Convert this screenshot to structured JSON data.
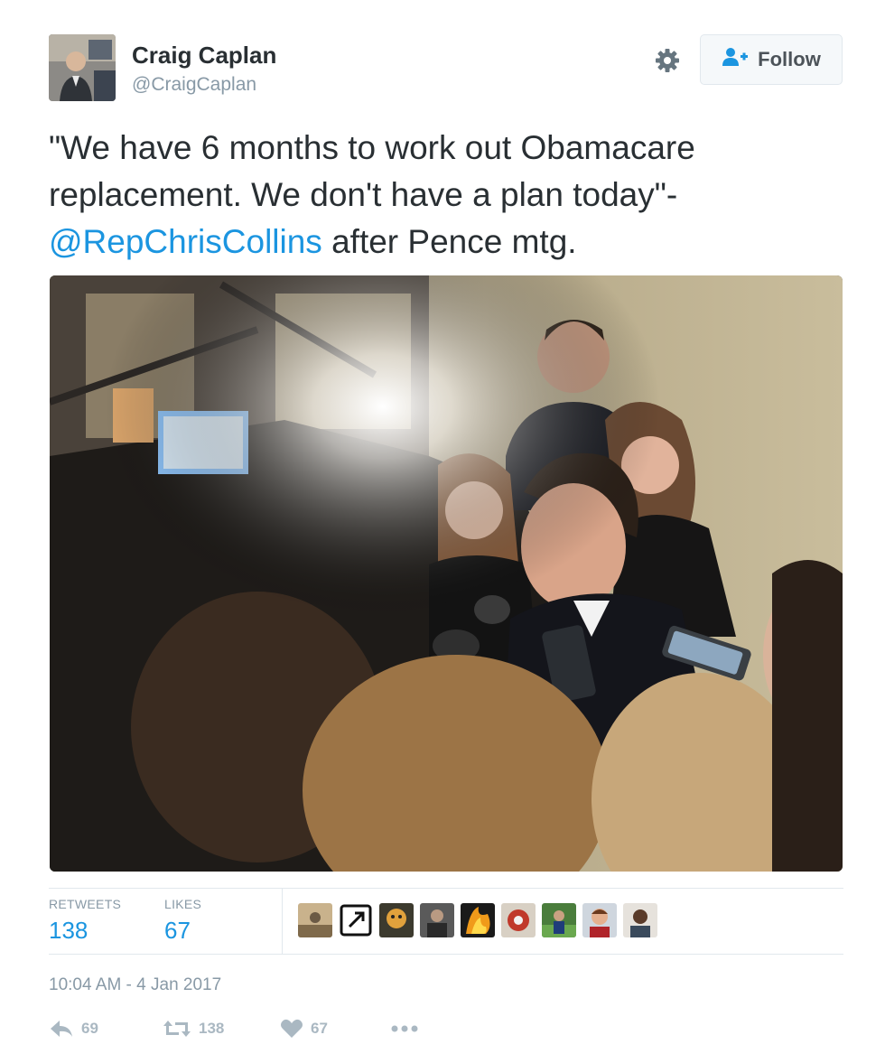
{
  "author": {
    "name": "Craig Caplan",
    "handle": "@CraigCaplan"
  },
  "header": {
    "settings_icon": "gear-icon",
    "follow_icon": "add-user-icon",
    "follow_label": "Follow"
  },
  "tweet": {
    "text_part1": "\"We have 6 months to work out Obamacare replacement. We don't have a plan today\"-",
    "mention": "@RepChrisCollins",
    "text_part2": " after Pence mtg."
  },
  "stats": {
    "retweets_label": "RETWEETS",
    "retweets_value": "138",
    "likes_label": "LIKES",
    "likes_value": "67"
  },
  "timestamp": "10:04 AM - 4 Jan 2017",
  "actions": {
    "reply_count": "69",
    "retweet_count": "138",
    "like_count": "67",
    "more_icon": "more-icon"
  },
  "colors": {
    "link": "#1b95e0",
    "text": "#292f33",
    "muted": "#8899a6",
    "action": "#aab8c2"
  }
}
